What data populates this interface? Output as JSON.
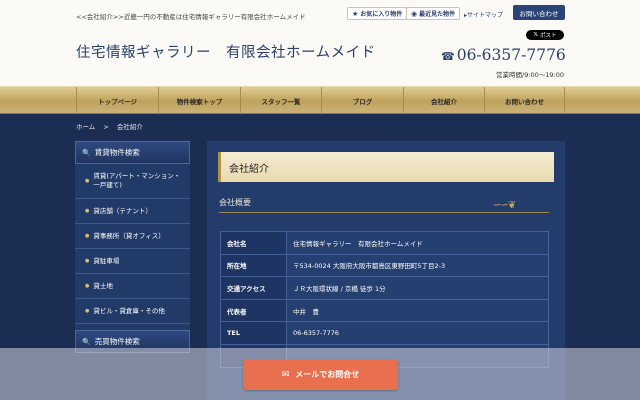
{
  "header": {
    "tagline": "<<会社紹介>>近畿一円の不動産は住宅情報ギャラリー有限会社ホームメイド",
    "title": "住宅情報ギャラリー　有限会社ホームメイド",
    "favorites_label": "お気に入り物件",
    "recent_label": "最近見た物件",
    "sitemap_label": "サイトマップ",
    "contact_label": "お問い合わせ",
    "x_post_label": "ポスト",
    "phone": "06-6357-7776",
    "hours": "営業時間/9:00～19:00"
  },
  "nav": {
    "items": [
      {
        "label": "トップページ"
      },
      {
        "label": "物件検索トップ"
      },
      {
        "label": "スタッフ一覧"
      },
      {
        "label": "ブログ"
      },
      {
        "label": "会社紹介"
      },
      {
        "label": "お問い合わせ"
      }
    ]
  },
  "breadcrumb": {
    "home": "ホーム",
    "sep": ">",
    "current": "会社紹介"
  },
  "sidebar": {
    "heading": "賃貸物件検索",
    "items": [
      {
        "label": "賃貸(アパート・マンション・一戸建て)"
      },
      {
        "label": "貸店舗（テナント）"
      },
      {
        "label": "貸事務所（貸オフィス）"
      },
      {
        "label": "貸駐車場"
      },
      {
        "label": "貸土地"
      },
      {
        "label": "貸ビル・貸倉庫・その他"
      }
    ],
    "heading2": "売買物件検索"
  },
  "main": {
    "page_title": "会社紹介",
    "section_title": "会社概要",
    "rows": [
      {
        "key": "会社名",
        "value": "住宅情報ギャラリー　有限会社ホームメイド"
      },
      {
        "key": "所在地",
        "value": "〒534-0024 大阪府大阪市都島区東野田町5丁目2-3"
      },
      {
        "key": "交通アクセス",
        "value": "ＪＲ大阪環状線 / 京橋 徒歩 1分"
      },
      {
        "key": "代表者",
        "value": "中井　豊"
      },
      {
        "key": "TEL",
        "value": "06-6357-7776"
      },
      {
        "key": "",
        "value": ""
      }
    ]
  },
  "float": {
    "label": "メールでお問合せ"
  },
  "icons": {
    "star": "star-icon",
    "eye": "eye-icon",
    "phone": "phone-icon",
    "mail": "mail-icon",
    "home": "home-icon"
  },
  "colors": {
    "navy": "#1b2d52",
    "gold": "#bfa25b",
    "accent": "#e8704f"
  }
}
